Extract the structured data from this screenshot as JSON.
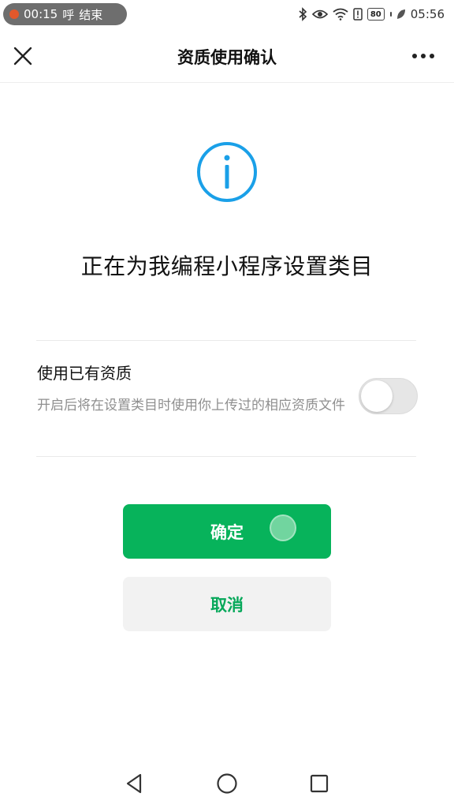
{
  "status_bar": {
    "call_timer": "00:15",
    "call_label": "呼",
    "end_label": "结束",
    "battery": "80",
    "time": "05:56",
    "icons": [
      "bluetooth-icon",
      "eye-icon",
      "wifi-icon",
      "alert-icon",
      "battery-icon",
      "leaf-icon"
    ]
  },
  "nav": {
    "title": "资质使用确认",
    "close_icon": "close-icon",
    "more_icon": "more-icon"
  },
  "content": {
    "info_icon": "info-icon",
    "info_color": "#1aa0e8",
    "headline": "正在为我编程小程序设置类目",
    "option_title": "使用已有资质",
    "option_desc": "开启后将在设置类目时使用你上传过的相应资质文件",
    "toggle_on": false
  },
  "buttons": {
    "confirm": "确定",
    "cancel": "取消",
    "primary_color": "#07b35b"
  },
  "system_nav": {
    "icons": [
      "back-icon",
      "home-icon",
      "recents-icon"
    ]
  }
}
